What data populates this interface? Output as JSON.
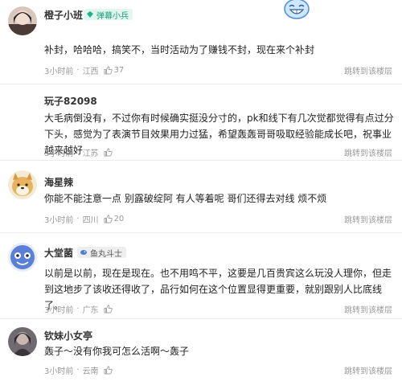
{
  "comments": [
    {
      "user": "橙子小班",
      "badge": "弹幕小兵",
      "text": "补封，哈哈哈，搞笑不，当时活动为了赚钱不封，现在来个补封",
      "time": "3小时前",
      "location": "江西",
      "likes": "37",
      "reply_label": "跳转到该楼层",
      "has_emoji": true,
      "emoji": "grinning-blue-face"
    },
    {
      "user": "玩子82098",
      "badge": "",
      "text": "大毛病倒没有，不过你有时候确实挺没分寸的，pk和线下有几次觉都觉得有点过分下头，感觉为了表演节目效果用力过猛，希望轰轰哥哥吸取经验能成长吧，祝事业越来越好",
      "time": "3小时前",
      "location": "江苏",
      "likes": "",
      "reply_label": "跳转到该楼层"
    },
    {
      "user": "海星辣",
      "badge": "",
      "text": "你能不能注意一点 别露破绽阿 有人等着呢 哥们还得去对线 烦不烦",
      "time": "3小时前",
      "location": "四川",
      "likes": "20",
      "reply_label": "跳转到该楼层"
    },
    {
      "user": "大堂菌",
      "badge": "鱼丸斗士",
      "text": "以前是以前，现在是现在。也不用鸣不平，这要是几百贵宾这么玩没人理你，但走到这地步了该收还得收了，品行如何在这个位置显得更重要，就别跟别人比底线了。",
      "time": "3小时前",
      "location": "广东",
      "likes": "",
      "reply_label": "跳转到该楼层"
    },
    {
      "user": "钦妹小女亭",
      "badge": "",
      "text": "轰子～没有你我可怎么活啊～轰子",
      "time": "3小时前",
      "location": "云南",
      "likes": "",
      "reply_label": "跳转到该楼层"
    }
  ],
  "colors": {
    "badge_teal": "#1f9d78",
    "text": "#222222",
    "meta": "#999999"
  }
}
